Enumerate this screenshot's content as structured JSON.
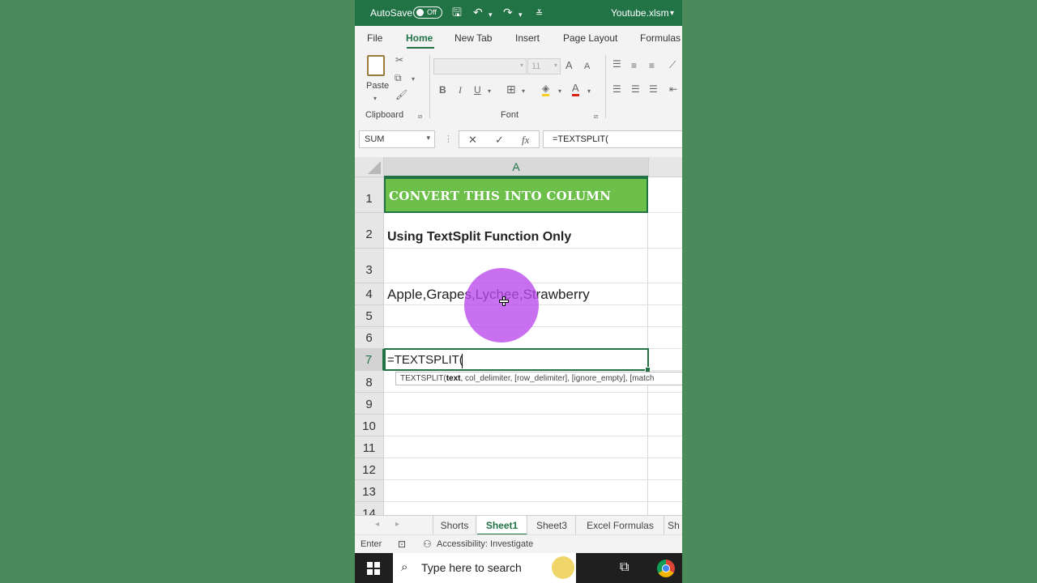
{
  "titlebar": {
    "autosave_label": "AutoSave",
    "autosave_state": "Off",
    "filename": "Youtube.xlsm"
  },
  "ribbon_tabs": [
    "File",
    "Home",
    "New Tab",
    "Insert",
    "Page Layout",
    "Formulas"
  ],
  "ribbon": {
    "clipboard": {
      "paste_label": "Paste",
      "group_label": "Clipboard"
    },
    "font": {
      "font_size": "11",
      "group_label": "Font",
      "bold": "B",
      "italic": "I",
      "underline": "U",
      "grow": "A",
      "shrink": "A",
      "font_color": "A"
    }
  },
  "formula_bar": {
    "name_box": "SUM",
    "cancel": "✕",
    "enter": "✓",
    "fx": "fx",
    "formula": "=TEXTSPLIT("
  },
  "grid": {
    "column_header": "A",
    "row_headers": [
      "1",
      "2",
      "3",
      "4",
      "5",
      "6",
      "7",
      "8",
      "9",
      "10",
      "11",
      "12",
      "13",
      "14"
    ],
    "cells": {
      "a1": "CONVERT THIS INTO COLUMN",
      "a2": "Using TextSplit Function Only",
      "a4": "Apple,Grapes,Lychee,Strawberry",
      "a7": "=TEXTSPLIT("
    },
    "tooltip": {
      "fn": "TEXTSPLIT(",
      "arg1": "text",
      "rest": ", col_delimiter, [row_delimiter], [ignore_empty], [match"
    }
  },
  "sheet_tabs": [
    "Shorts",
    "Sheet1",
    "Sheet3",
    "Excel Formulas",
    "Sh"
  ],
  "active_sheet": "Sheet1",
  "status": {
    "mode": "Enter",
    "accessibility": "Accessibility: Investigate"
  },
  "taskbar": {
    "search_placeholder": "Type here to search"
  },
  "colors": {
    "excel_green": "#217346",
    "banner_fill": "#6cc04a",
    "click_highlight": "#b848ec"
  }
}
